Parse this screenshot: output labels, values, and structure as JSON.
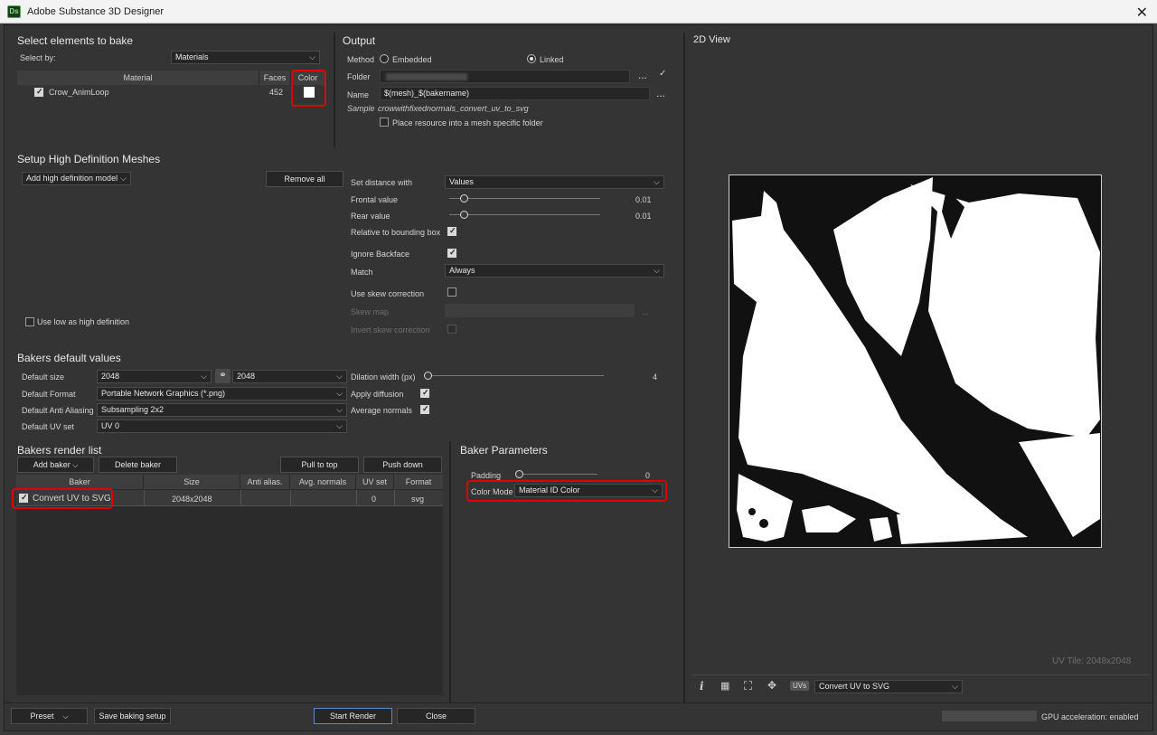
{
  "window": {
    "title": "Adobe Substance 3D Designer",
    "logo": "Ds"
  },
  "select_elements": {
    "heading": "Select elements to bake",
    "select_by_label": "Select by:",
    "select_by_value": "Materials",
    "columns": {
      "material": "Material",
      "faces": "Faces",
      "color": "Color"
    },
    "rows": [
      {
        "name": "Crow_AnimLoop",
        "faces": "452",
        "checked": true
      }
    ]
  },
  "output": {
    "heading": "Output",
    "method_label": "Method",
    "embedded_label": "Embedded",
    "linked_label": "Linked",
    "folder_label": "Folder",
    "name_label": "Name",
    "name_value": "$(mesh)_$(bakername)",
    "sample_label": "Sample",
    "sample_value": "crowwithfixednormals_convert_uv_to_svg",
    "place_resource_label": "Place resource into a mesh specific folder",
    "ellipsis": "..."
  },
  "high_def": {
    "heading": "Setup High Definition Meshes",
    "add_model": "Add high definition model",
    "remove_all": "Remove all",
    "use_low_as_high": "Use low as high definition",
    "set_distance_label": "Set distance with",
    "set_distance_value": "Values",
    "frontal_label": "Frontal value",
    "frontal_value": "0.01",
    "rear_label": "Rear value",
    "rear_value": "0.01",
    "relative_bbox": "Relative to bounding box",
    "ignore_backface": "Ignore Backface",
    "match_label": "Match",
    "match_value": "Always",
    "skew_correction": "Use skew correction",
    "skew_map": "Skew map",
    "invert_skew": "Invert skew correction"
  },
  "defaults": {
    "heading": "Bakers default values",
    "size_label": "Default size",
    "size_w": "2048",
    "size_h": "2048",
    "format_label": "Default Format",
    "format_value": "Portable Network Graphics (*.png)",
    "aa_label": "Default Anti Aliasing",
    "aa_value": "Subsampling 2x2",
    "uvset_label": "Default UV set",
    "uvset_value": "UV 0",
    "dilation_label": "Dilation width (px)",
    "dilation_value": "4",
    "apply_diffusion": "Apply diffusion",
    "average_normals": "Average normals"
  },
  "render_list": {
    "heading": "Bakers render list",
    "add_baker": "Add baker",
    "delete_baker": "Delete baker",
    "pull_to_top": "Pull to top",
    "push_down": "Push down",
    "columns": [
      "Baker",
      "Size",
      "Anti alias.",
      "Avg. normals",
      "UV set",
      "Format"
    ],
    "rows": [
      {
        "baker": "Convert UV to SVG",
        "size": "2048x2048",
        "aa": "",
        "avg": "",
        "uvset": "0",
        "format": "svg"
      }
    ]
  },
  "baker_params": {
    "heading": "Baker Parameters",
    "padding_label": "Padding",
    "padding_value": "0",
    "color_mode_label": "Color Mode",
    "color_mode_value": "Material ID Color"
  },
  "view2d": {
    "heading": "2D View",
    "uv_tile": "UV Tile: 2048x2048",
    "uvs_badge": "UVs",
    "baker_select": "Convert UV to SVG",
    "info_icon": "i"
  },
  "footer": {
    "preset": "Preset",
    "save_setup": "Save baking setup",
    "start_render": "Start Render",
    "close": "Close",
    "gpu": "GPU acceleration: enabled"
  },
  "colors": {
    "highlight": "#e00000",
    "panel": "#343434",
    "field": "#262626",
    "primary_border": "#5a8ccc"
  }
}
